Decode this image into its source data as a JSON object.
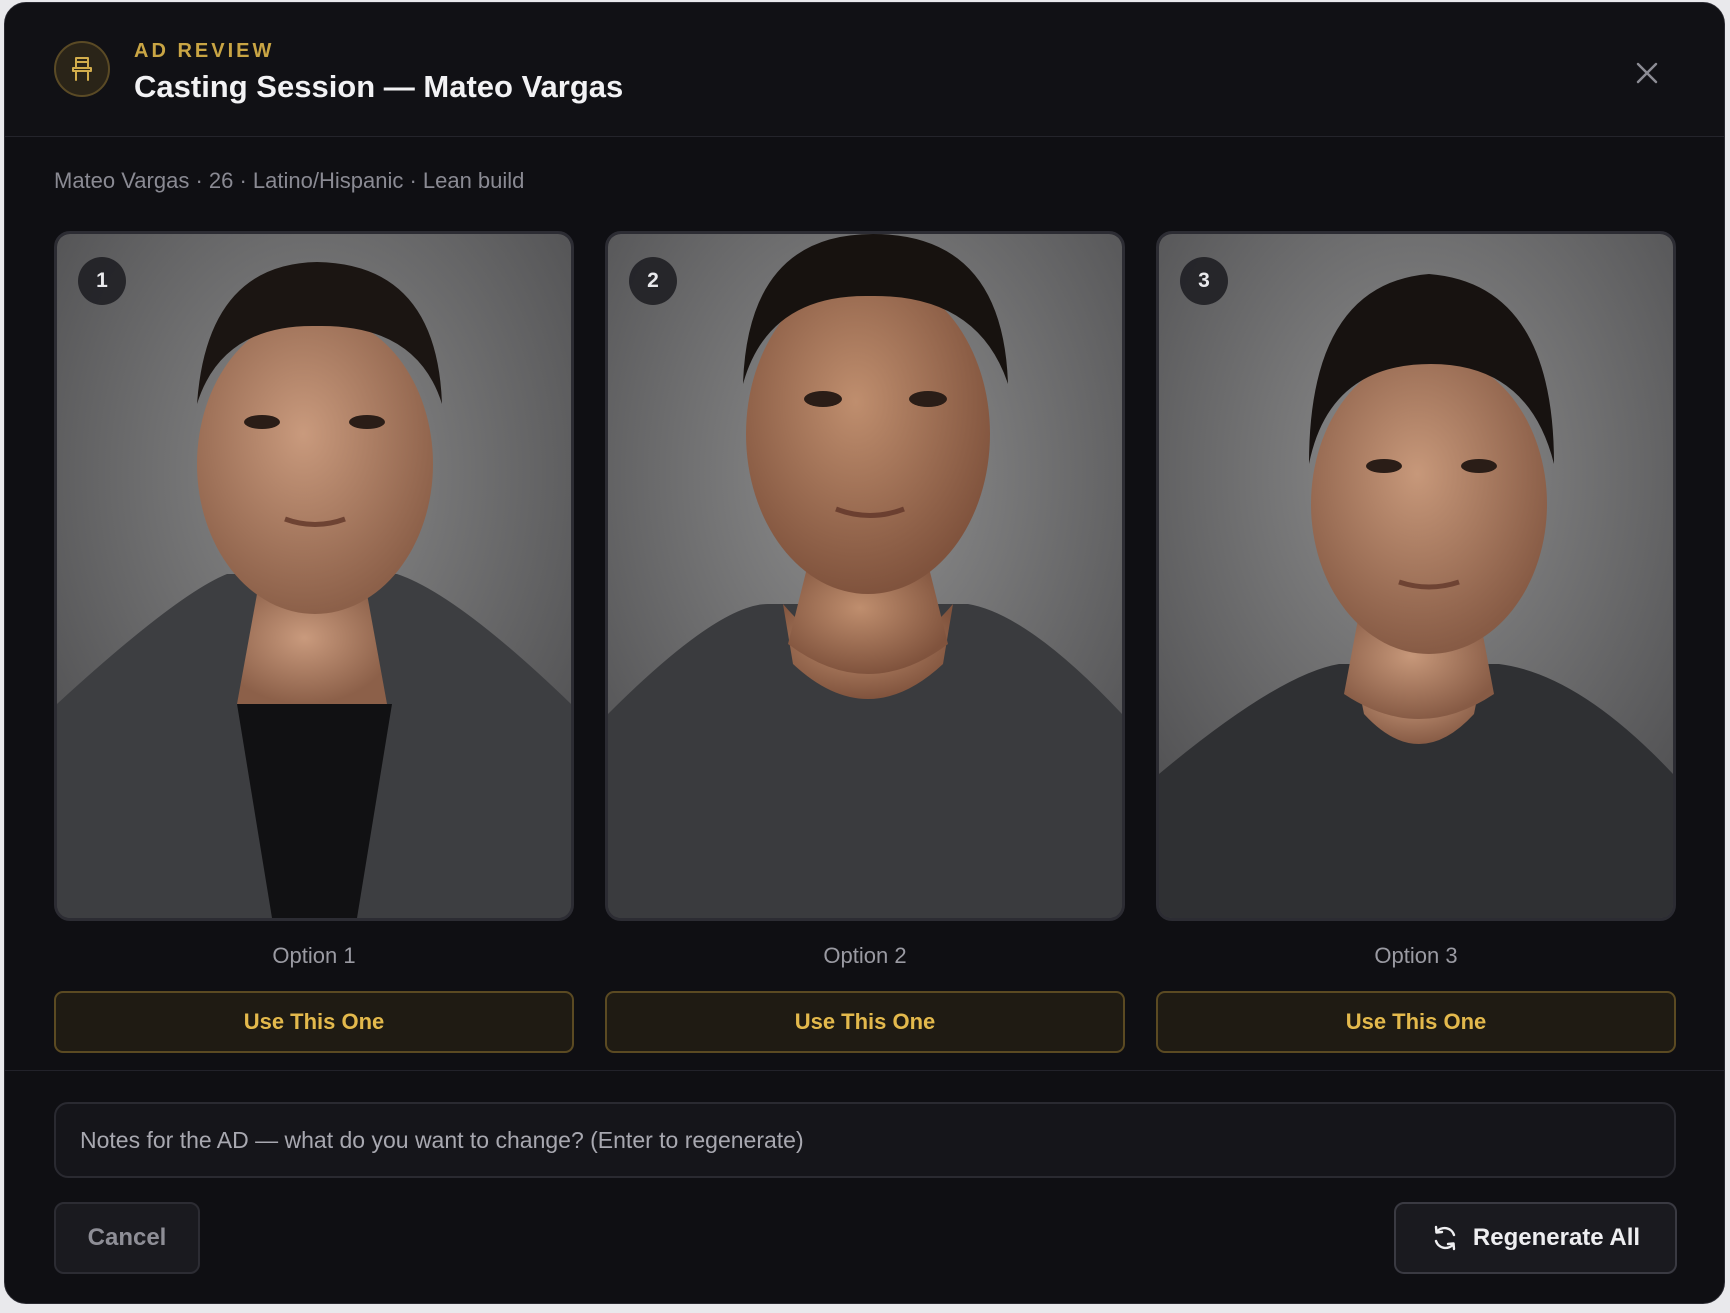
{
  "header": {
    "eyebrow": "AD REVIEW",
    "title": "Casting Session — Mateo Vargas",
    "icon": "chair-icon",
    "close_icon": "close-icon"
  },
  "meta": "Mateo Vargas · 26 · Latino/Hispanic · Lean build",
  "options": [
    {
      "number": "1",
      "label": "Option 1",
      "button": "Use This One"
    },
    {
      "number": "2",
      "label": "Option 2",
      "button": "Use This One"
    },
    {
      "number": "3",
      "label": "Option 3",
      "button": "Use This One"
    }
  ],
  "notes": {
    "placeholder": "Notes for the AD — what do you want to change? (Enter to regenerate)",
    "value": ""
  },
  "footer": {
    "cancel_label": "Cancel",
    "regenerate_label": "Regenerate All",
    "regenerate_icon": "refresh-icon"
  },
  "colors": {
    "accent": "#c9a544",
    "button_text": "#e3b94c",
    "background": "#0f0f13"
  }
}
